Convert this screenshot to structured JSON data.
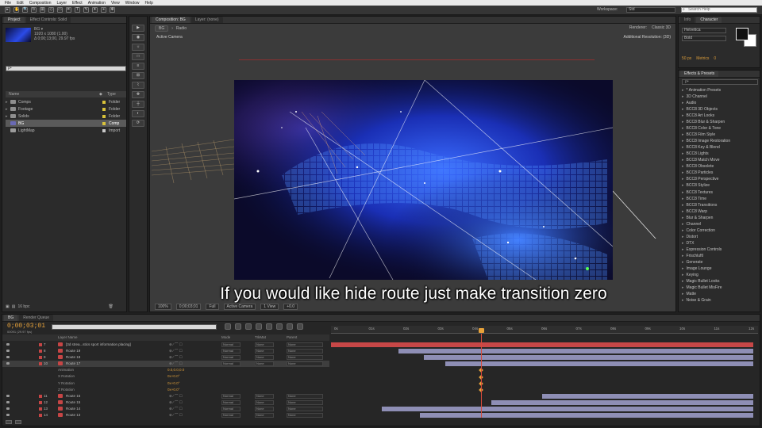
{
  "menu": [
    "File",
    "Edit",
    "Composition",
    "Layer",
    "Effect",
    "Animation",
    "View",
    "Window",
    "Help"
  ],
  "toolbar": {
    "tools": [
      "▸",
      "✋",
      "🔍",
      "↻",
      "⊞",
      "◇",
      "▭",
      "✒",
      "T",
      "✎",
      "✦",
      "⌖",
      "✥"
    ],
    "workspace_label": "Workspace:",
    "workspace_value": "Std",
    "search_placeholder": "Search Help"
  },
  "project": {
    "tabs": [
      "Project",
      "Effect Controls: Solid"
    ],
    "comp_name": "BG ▾",
    "comp_info": [
      "1920 x 1080 (1.00)",
      "Δ 0;00;13;00, 29.97 fps"
    ],
    "search_value": "ρ•",
    "col_name": "Name",
    "col_type": "Type",
    "items": [
      {
        "name": "Comps",
        "type": "Folder",
        "color": "#d9c23a",
        "icon": "folder-icon",
        "folder": true
      },
      {
        "name": "Footage",
        "type": "Folder",
        "color": "#d9c23a",
        "icon": "folder-icon",
        "folder": true
      },
      {
        "name": "Solids",
        "type": "Folder",
        "color": "#d9c23a",
        "icon": "folder-icon",
        "folder": true
      },
      {
        "name": "BG",
        "type": "Comp",
        "color": "#d9c23a",
        "icon": "composition-icon",
        "folder": false
      },
      {
        "name": "LightMap",
        "type": "Import",
        "color": "#c9c9c9",
        "icon": "footage-icon",
        "folder": false
      }
    ],
    "bpc": "16 bpc"
  },
  "viewer": {
    "tabs": [
      "Composition: BG",
      "Layer: (none)"
    ],
    "flow": [
      "BG",
      "Radio"
    ],
    "renderer_label": "Renderer:",
    "renderer_value": "Classic 3D",
    "active_camera": "Active Camera",
    "additional_info": "Additional Resolution: (3D)",
    "subtitle": "If you would like hide route just make transition zero",
    "bottom_bar": [
      "100%",
      "0;00;03;01",
      "Full",
      "Active Camera",
      "1 View",
      "+0.0"
    ]
  },
  "info": {
    "tabs": [
      "Info",
      "Character"
    ],
    "font": "Helvetica",
    "style": "Bold",
    "size": "50 px",
    "numbers": [
      "50 px",
      "Metrics",
      "0"
    ]
  },
  "effects": {
    "tab": "Effects & Presets",
    "search_placeholder": "ρ•",
    "items": [
      "* Animation Presets",
      "3D Channel",
      "Audio",
      "BCC8 3D Objects",
      "BCC8 Art Looks",
      "BCC8 Blur & Sharpen",
      "BCC8 Color & Tone",
      "BCC8 Film Style",
      "BCC8 Image Restoration",
      "BCC8 Key & Blend",
      "BCC8 Lights",
      "BCC8 Match Move",
      "BCC8 Obsolete",
      "BCC8 Particles",
      "BCC8 Perspective",
      "BCC8 Stylize",
      "BCC8 Textures",
      "BCC8 Time",
      "BCC8 Transitions",
      "BCC8 Warp",
      "Blur & Sharpen",
      "Channel",
      "Color Correction",
      "Distort",
      "DTX",
      "Expression Controls",
      "FrischluftI",
      "Generate",
      "Image Lounge",
      "Keying",
      "Magic Bullet Looks",
      "Magic Bullet MisFire",
      "Matte",
      "Noise & Grain"
    ]
  },
  "timeline": {
    "tabs": [
      "BG",
      "Render Queue"
    ],
    "timecode": "0;00;03;01",
    "framecount": "00091 (29.97 fps)",
    "ruler_marks": [
      "0s",
      "01s",
      "02s",
      "03s",
      "04s",
      "05s",
      "06s",
      "07s",
      "08s",
      "09s",
      "10s",
      "11s",
      "12s"
    ],
    "col_source": "Layer Name",
    "col_mode": "Mode",
    "col_trkmat": "TrkMat",
    "col_parent": "Parent",
    "layers": [
      {
        "kind": "layer",
        "num": "7",
        "name": "[3d strea...stics sport information placing]",
        "label": "#c64545",
        "icon": "#c64545",
        "mode": "Normal",
        "trk": "None",
        "parent": "None",
        "selected": false
      },
      {
        "kind": "layer",
        "num": "8",
        "name": "Route 19",
        "label": "#c64545",
        "icon": "#c64545",
        "mode": "Normal",
        "trk": "None",
        "parent": "None",
        "selected": false
      },
      {
        "kind": "layer",
        "num": "9",
        "name": "Route 18",
        "label": "#c64545",
        "icon": "#c64545",
        "mode": "Normal",
        "trk": "None",
        "parent": "None",
        "selected": false
      },
      {
        "kind": "layer",
        "num": "10",
        "name": "Route 17",
        "label": "#c64545",
        "icon": "#c64545",
        "mode": "Normal",
        "trk": "None",
        "parent": "None",
        "selected": true
      },
      {
        "kind": "prop",
        "name": "Animation",
        "value": "0.0,0.0,0.0"
      },
      {
        "kind": "prop",
        "name": "X Rotation",
        "value": "0x+0.0°"
      },
      {
        "kind": "prop",
        "name": "Y Rotation",
        "value": "0x+0.0°"
      },
      {
        "kind": "prop",
        "name": "Z Rotation",
        "value": "0x+0.0°"
      },
      {
        "kind": "layer",
        "num": "11",
        "name": "Route 16",
        "label": "#c64545",
        "icon": "#c64545",
        "mode": "Normal",
        "trk": "None",
        "parent": "None",
        "selected": false
      },
      {
        "kind": "layer",
        "num": "12",
        "name": "Route 15",
        "label": "#c64545",
        "icon": "#c64545",
        "mode": "Normal",
        "trk": "None",
        "parent": "None",
        "selected": false
      },
      {
        "kind": "layer",
        "num": "13",
        "name": "Route 14",
        "label": "#c64545",
        "icon": "#c64545",
        "mode": "Normal",
        "trk": "None",
        "parent": "None",
        "selected": false
      },
      {
        "kind": "layer",
        "num": "14",
        "name": "Route 13",
        "label": "#c64545",
        "icon": "#c64545",
        "mode": "Normal",
        "trk": "None",
        "parent": "None",
        "selected": false
      }
    ],
    "bars": [
      {
        "start": 0,
        "end": 1,
        "color": "red"
      },
      {
        "start": 0.16,
        "end": 1,
        "color": "lav"
      },
      {
        "start": 0.22,
        "end": 1,
        "color": "lav"
      },
      {
        "start": 0.27,
        "end": 1,
        "color": "lav"
      },
      {
        "start": 0,
        "end": 0,
        "color": "none"
      },
      {
        "start": 0,
        "end": 0,
        "color": "none"
      },
      {
        "start": 0,
        "end": 0,
        "color": "none"
      },
      {
        "start": 0,
        "end": 0,
        "color": "none"
      },
      {
        "start": 0.5,
        "end": 1,
        "color": "lav"
      },
      {
        "start": 0.38,
        "end": 1,
        "color": "lav"
      },
      {
        "start": 0.12,
        "end": 1,
        "color": "lav"
      },
      {
        "start": 0.21,
        "end": 1,
        "color": "lav"
      }
    ]
  }
}
